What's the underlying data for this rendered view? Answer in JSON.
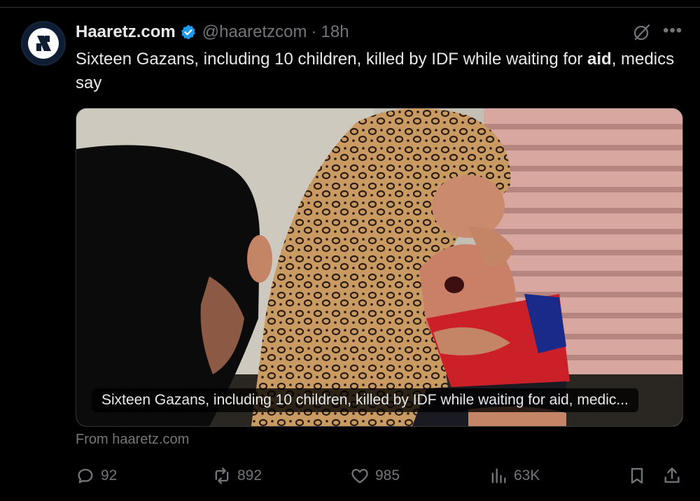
{
  "tweet": {
    "author_name": "Haaretz.com",
    "handle": "@haaretzcom",
    "separator": "·",
    "time": "18h",
    "text_before": "Sixteen Gazans, including 10 children, killed by IDF while waiting for ",
    "text_bold": "aid",
    "text_after": ", medics say",
    "more_label": "•••"
  },
  "card": {
    "caption": "Sixteen Gazans, including 10 children, killed by IDF while waiting for aid, medic..."
  },
  "source": {
    "label": "From haaretz.com"
  },
  "actions": {
    "replies": "92",
    "reposts": "892",
    "likes": "985",
    "views": "63K"
  },
  "colors": {
    "background": "#000000",
    "text": "#e7e9ea",
    "muted": "#71767b",
    "verified": "#1d9bf0",
    "border": "#2f3336"
  }
}
